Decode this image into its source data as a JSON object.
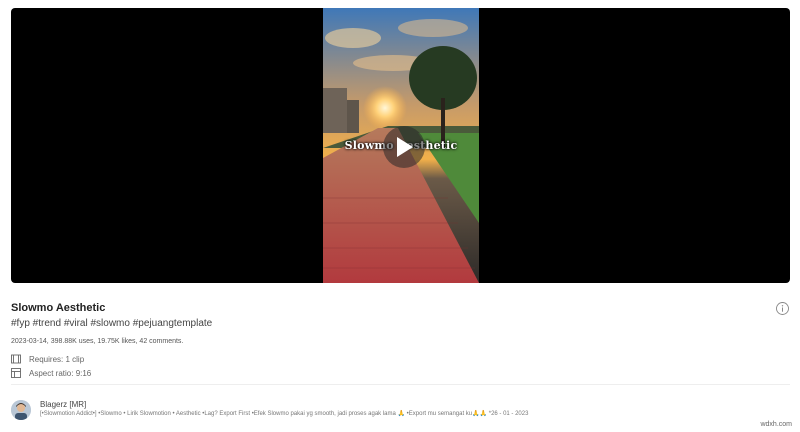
{
  "video": {
    "overlay_text": "Slowmo Aesthetic"
  },
  "template": {
    "title": "Slowmo Aesthetic",
    "hashtags": "#fyp #trend #viral #slowmo #pejuangtemplate",
    "stats": "2023-03-14, 398.88K uses, 19.75K likes, 42 comments.",
    "requires": "Requires: 1 clip",
    "aspect_ratio": "Aspect ratio: 9:16"
  },
  "author": {
    "name": "Blagerz [MR]",
    "description": "[•Slowmotion Addict•] •Slowmo • Lirik Slowmotion • Aesthetic •Lag? Export First •Efek Slowmo pakai yg smooth, jadi proses agak lama 🙏 •Export mu semangat ku🙏🙏 *26 - 01 - 2023"
  },
  "watermark": "wdxh.com",
  "colors": {
    "player_bg": "#000000",
    "page_bg": "#ffffff"
  },
  "icons": {
    "play": "play-icon",
    "info": "info-icon",
    "clip": "film-icon",
    "aspect": "aspect-icon"
  }
}
